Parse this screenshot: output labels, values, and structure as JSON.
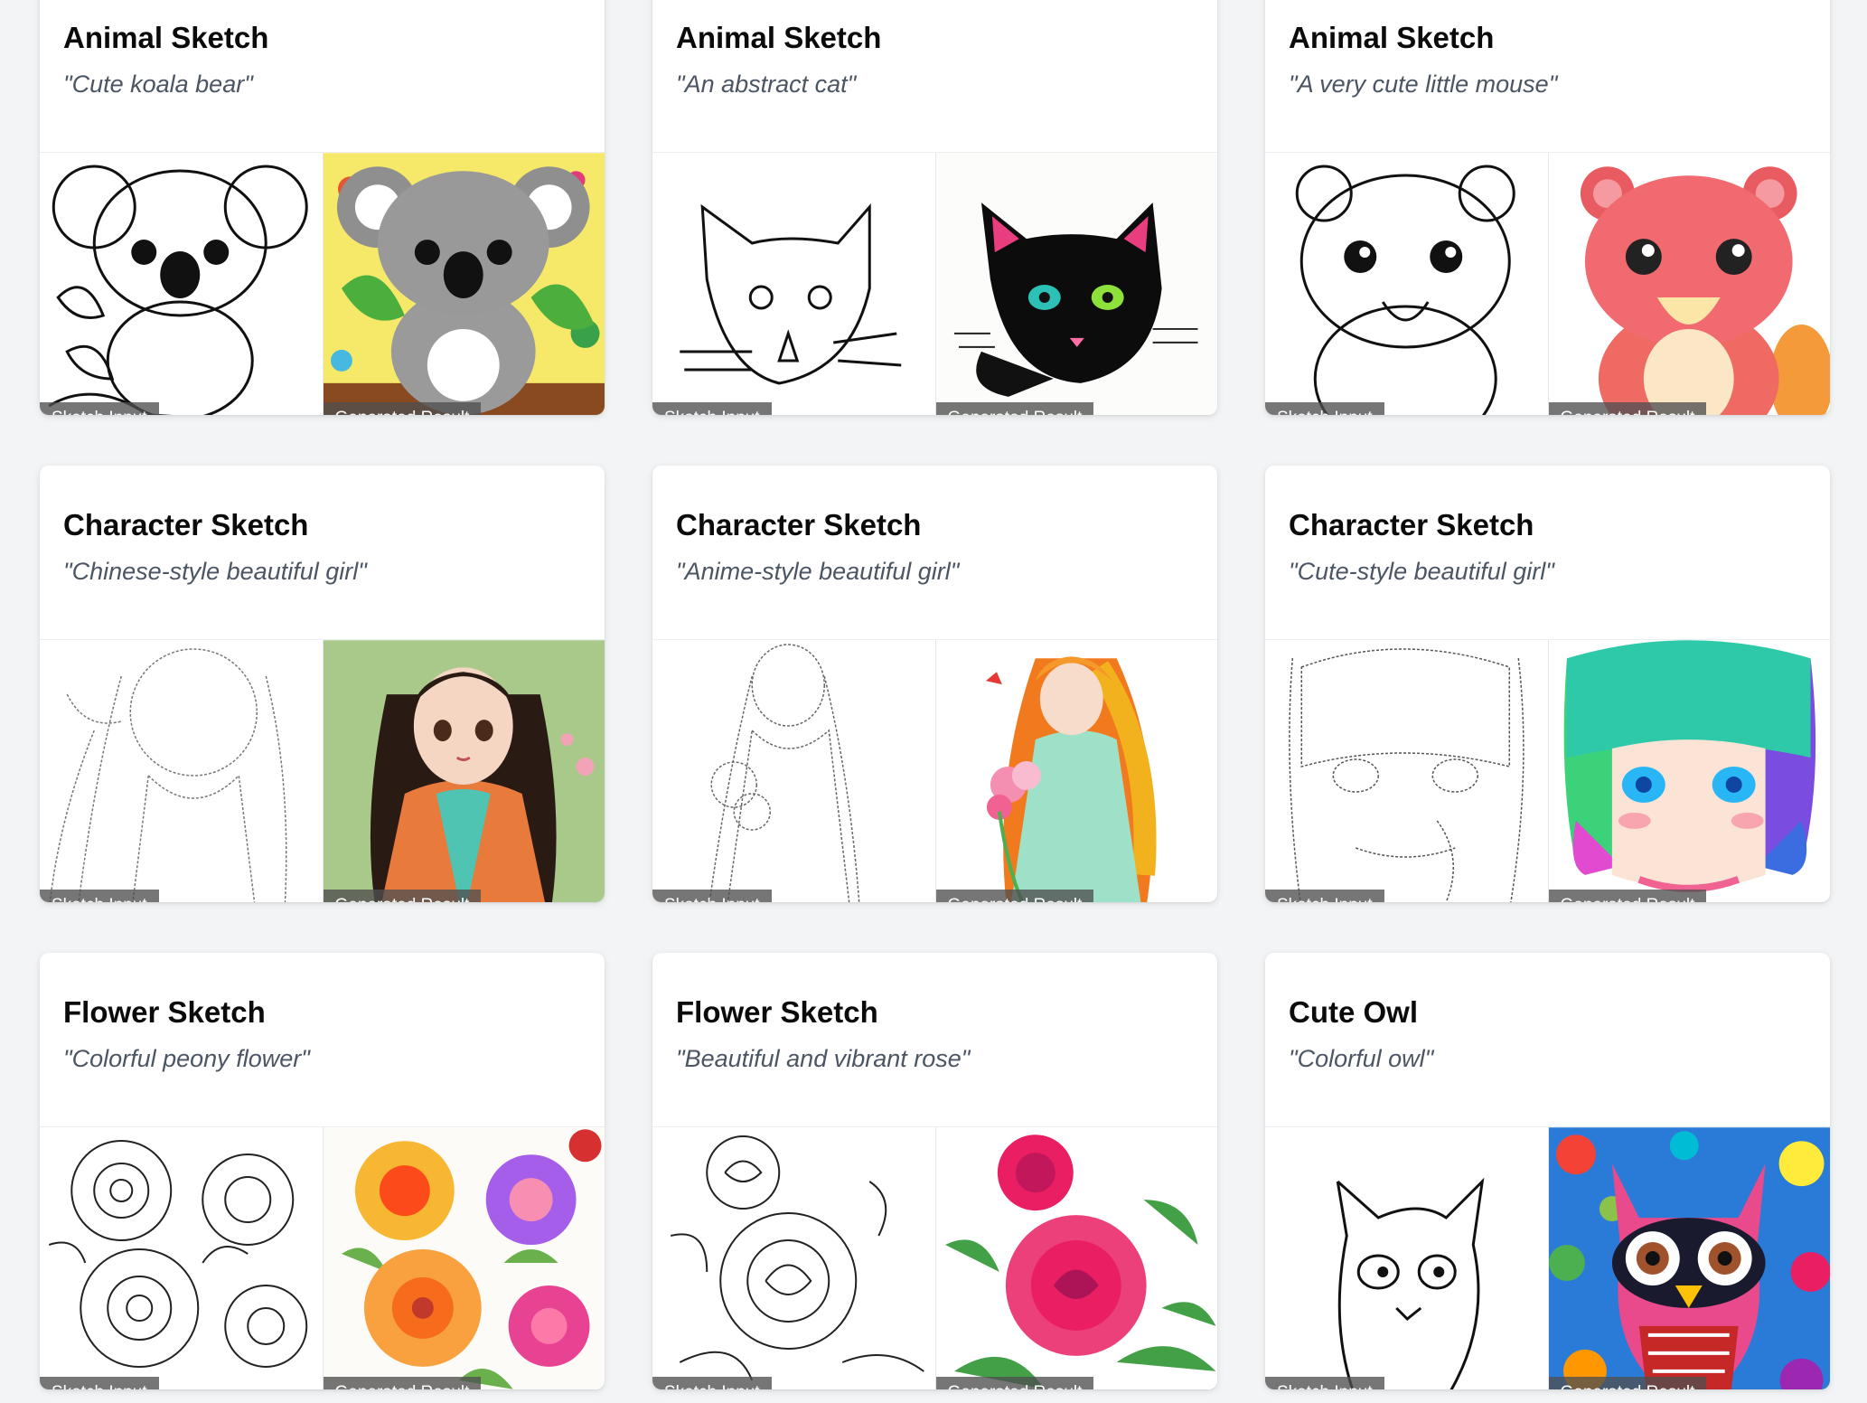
{
  "labels": {
    "sketch": "Sketch Input",
    "result": "Generated Result"
  },
  "cards": [
    {
      "title": "Animal Sketch",
      "prompt": "\"Cute koala bear\""
    },
    {
      "title": "Animal Sketch",
      "prompt": "\"An abstract cat\""
    },
    {
      "title": "Animal Sketch",
      "prompt": "\"A very cute little mouse\""
    },
    {
      "title": "Character Sketch",
      "prompt": "\"Chinese-style beautiful girl\""
    },
    {
      "title": "Character Sketch",
      "prompt": "\"Anime-style beautiful girl\""
    },
    {
      "title": "Character Sketch",
      "prompt": "\"Cute-style beautiful girl\""
    },
    {
      "title": "Flower Sketch",
      "prompt": "\"Colorful peony flower\""
    },
    {
      "title": "Flower Sketch",
      "prompt": "\"Beautiful and vibrant rose\""
    },
    {
      "title": "Cute Owl",
      "prompt": "\"Colorful owl\""
    }
  ]
}
